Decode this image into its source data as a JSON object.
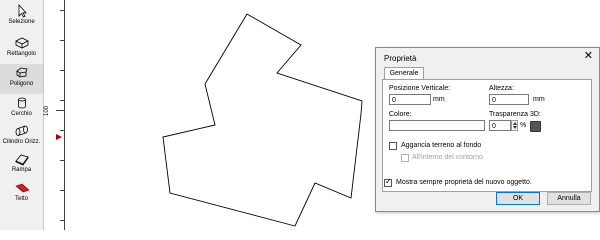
{
  "toolbar": {
    "tools": [
      {
        "label": "Selezione",
        "icon": "cursor-arrow-icon"
      },
      {
        "label": "Rettangolo",
        "icon": "rectangle-box-icon"
      },
      {
        "label": "Poligono",
        "icon": "polygon-prism-icon",
        "selected": true
      },
      {
        "label": "Cerchio",
        "icon": "cylinder-icon"
      },
      {
        "label": "Cilindro Orizz.",
        "icon": "horizontal-cylinder-icon"
      },
      {
        "label": "Rampa",
        "icon": "ramp-icon"
      },
      {
        "label": "Tetto",
        "icon": "roof-icon",
        "color": "#cc1f1f"
      }
    ]
  },
  "ruler": {
    "label": "100",
    "marker_color": "#b00000"
  },
  "dialog": {
    "title": "Proprietà",
    "close_icon": "close-icon",
    "tab_label": "Generale",
    "fields": {
      "vertical_position_label": "Posizione Verticale:",
      "vertical_position_value": "0",
      "vertical_position_unit": "mm",
      "height_label": "Altezza:",
      "height_value": "0",
      "height_unit": "mm",
      "color_label": "Colore:",
      "color_value": "",
      "transparency_label": "Trasparenza 3D:",
      "transparency_value": "0",
      "transparency_unit": "%"
    },
    "checkboxes": {
      "attach_ground_label": "Aggancia terreno al fondo",
      "attach_ground_checked": false,
      "inside_contour_label": "All'interno del contorno",
      "inside_contour_checked": false,
      "always_show_label": "Mostra sempre proprietà del nuovo oggetto.",
      "always_show_checked": true
    },
    "buttons": {
      "ok_label": "OK",
      "cancel_label": "Annulla"
    }
  }
}
